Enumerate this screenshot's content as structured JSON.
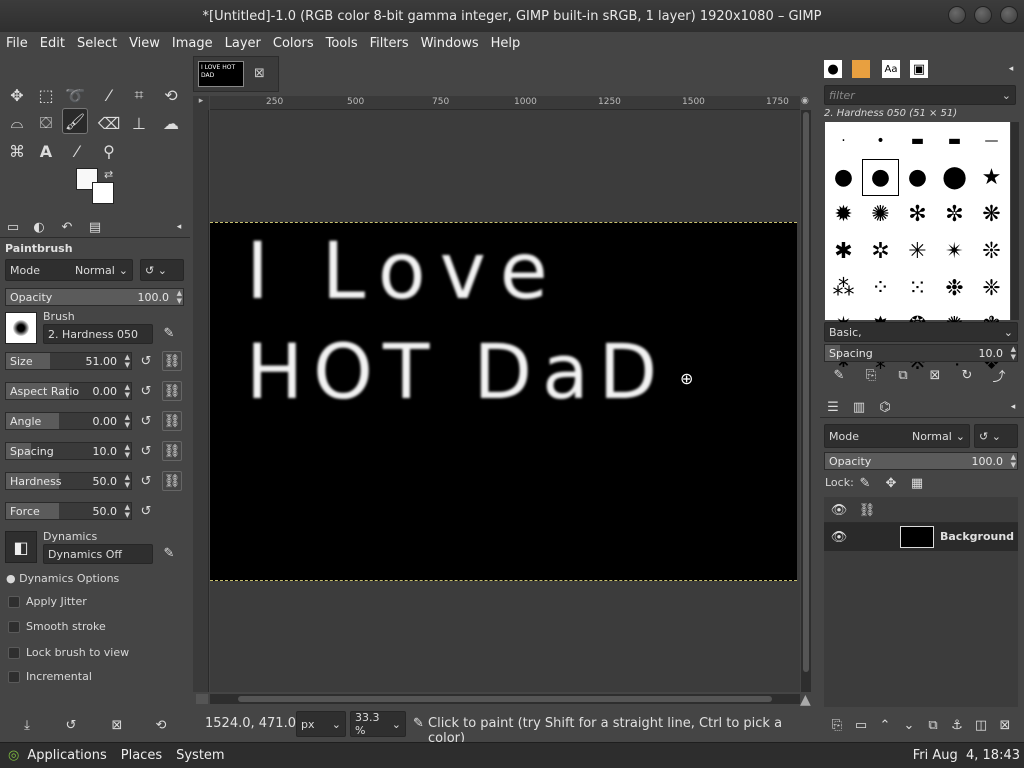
{
  "window": {
    "title": "*[Untitled]-1.0 (RGB color 8-bit gamma integer, GIMP built-in sRGB, 1 layer) 1920x1080 – GIMP"
  },
  "menu": [
    "File",
    "Edit",
    "Select",
    "View",
    "Image",
    "Layer",
    "Colors",
    "Tools",
    "Filters",
    "Windows",
    "Help"
  ],
  "tool_options": {
    "title": "Paintbrush",
    "mode_label": "Mode",
    "mode_value": "Normal",
    "opacity_label": "Opacity",
    "opacity_value": "100.0",
    "opacity_fraction": 1.0,
    "brush_label": "Brush",
    "brush_value": "2. Hardness 050",
    "sliders": [
      {
        "label": "Size",
        "value": "51.00",
        "fraction": 0.35
      },
      {
        "label": "Aspect Ratio",
        "value": "0.00",
        "fraction": 0.5
      },
      {
        "label": "Angle",
        "value": "0.00",
        "fraction": 0.42
      },
      {
        "label": "Spacing",
        "value": "10.0",
        "fraction": 0.2
      },
      {
        "label": "Hardness",
        "value": "50.0",
        "fraction": 0.42
      },
      {
        "label": "Force",
        "value": "50.0",
        "fraction": 0.42
      }
    ],
    "dynamics_label": "Dynamics",
    "dynamics_value": "Dynamics Off",
    "dynamics_options": "Dynamics Options",
    "checkboxes": [
      "Apply Jitter",
      "Smooth stroke",
      "Lock brush to view",
      "Incremental"
    ]
  },
  "ruler": {
    "top_ticks": [
      "250",
      "500",
      "750",
      "1000",
      "1250",
      "1500",
      "1750"
    ]
  },
  "image_tab_thumb_text": "I LOVE HOT DAD",
  "canvas_text": {
    "line1": "I Love",
    "line2": "HOT DaD"
  },
  "status": {
    "coords": "1524.0, 471.0",
    "unit": "px",
    "zoom": "33.3 %",
    "message": "Click to paint (try Shift for a straight line, Ctrl to pick a color)"
  },
  "brushes": {
    "filter_placeholder": "filter",
    "selected": "2. Hardness 050 (51 × 51)",
    "tag": "Basic,",
    "spacing_label": "Spacing",
    "spacing_value": "10.0"
  },
  "layers": {
    "mode_label": "Mode",
    "mode_value": "Normal",
    "opacity_label": "Opacity",
    "opacity_value": "100.0",
    "lock_label": "Lock:",
    "layer_name": "Background"
  },
  "taskbar": {
    "items": [
      "Applications",
      "Places",
      "System"
    ],
    "clock": "Fri Aug  4, 18:43"
  },
  "colors": {
    "accent_fg": "#f8f8f8",
    "bg": "#ffffff"
  }
}
